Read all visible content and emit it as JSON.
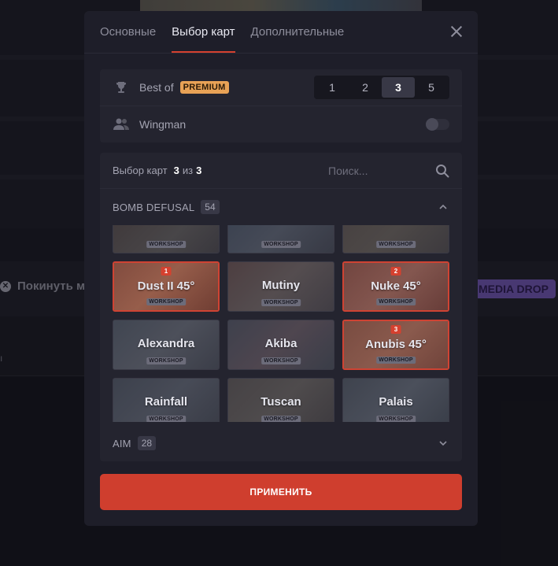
{
  "background": {
    "leave_label": "Покинуть м",
    "media_drop_label": "MEDIA DROP",
    "leave_icon": "close-circle-icon"
  },
  "modal": {
    "tabs": [
      {
        "label": "Основные",
        "active": false
      },
      {
        "label": "Выбор карт",
        "active": true
      },
      {
        "label": "Дополнительные",
        "active": false
      }
    ],
    "close_icon": "close-icon",
    "best_of": {
      "label": "Best of",
      "badge": "PREMIUM",
      "icon": "trophy-icon",
      "options": [
        "1",
        "2",
        "3",
        "5"
      ],
      "selected": "3"
    },
    "wingman": {
      "label": "Wingman",
      "icon": "users-icon",
      "enabled": false
    },
    "map_select": {
      "label": "Выбор карт",
      "selected_count": "3",
      "of_label": "из",
      "max_count": "3",
      "search_placeholder": "Поиск...",
      "search_icon": "search-icon"
    },
    "categories": [
      {
        "name": "BOMB DEFUSAL",
        "count": "54",
        "expanded": true
      },
      {
        "name": "AIM",
        "count": "28",
        "expanded": false
      }
    ],
    "workshop_label": "WORKSHOP",
    "maps": [
      {
        "name": "",
        "selected": false,
        "order": ""
      },
      {
        "name": "",
        "selected": false,
        "order": ""
      },
      {
        "name": "",
        "selected": false,
        "order": ""
      },
      {
        "name": "Dust II 45°",
        "selected": true,
        "order": "1"
      },
      {
        "name": "Mutiny",
        "selected": false,
        "order": ""
      },
      {
        "name": "Nuke 45°",
        "selected": true,
        "order": "2"
      },
      {
        "name": "Alexandra",
        "selected": false,
        "order": ""
      },
      {
        "name": "Akiba",
        "selected": false,
        "order": ""
      },
      {
        "name": "Anubis 45°",
        "selected": true,
        "order": "3"
      },
      {
        "name": "Rainfall",
        "selected": false,
        "order": ""
      },
      {
        "name": "Tuscan",
        "selected": false,
        "order": ""
      },
      {
        "name": "Palais",
        "selected": false,
        "order": ""
      }
    ],
    "apply_label": "ПРИМЕНИТЬ",
    "colors": {
      "accent": "#cf3e2e",
      "premium": "#e8a256",
      "media_drop": "#6b52a8"
    }
  }
}
